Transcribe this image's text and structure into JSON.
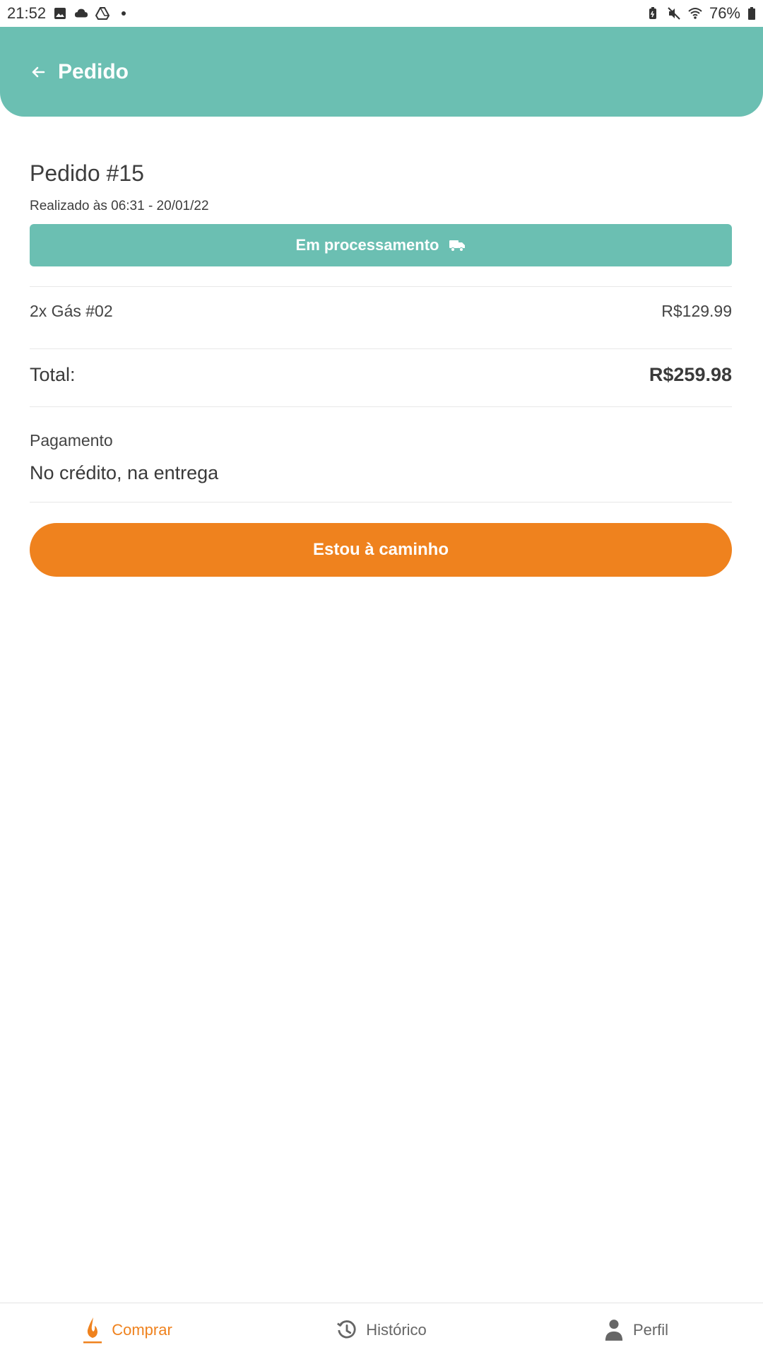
{
  "status_bar": {
    "time": "21:52",
    "battery": "76%",
    "left_icons": [
      "image-icon",
      "cloud-icon",
      "drive-icon",
      "dot-icon"
    ],
    "right_icons": [
      "battery-saver-icon",
      "mute-icon",
      "wifi-icon",
      "battery-icon"
    ]
  },
  "header": {
    "title": "Pedido",
    "back_icon": "arrow-left-icon"
  },
  "order": {
    "title": "Pedido #15",
    "date": "Realizado às 06:31 - 20/01/22",
    "status_label": "Em processamento",
    "status_icon": "truck-icon",
    "item_label": "2x Gás #02",
    "item_price": "R$129.99",
    "total_label": "Total:",
    "total_value": "R$259.98",
    "payment_label": "Pagamento",
    "payment_value": "No crédito, na entrega",
    "action_button": "Estou à caminho"
  },
  "nav": {
    "items": [
      {
        "label": "Comprar",
        "icon": "flame-icon",
        "active": true
      },
      {
        "label": "Histórico",
        "icon": "history-icon",
        "active": false
      },
      {
        "label": "Perfil",
        "icon": "person-icon",
        "active": false
      }
    ]
  },
  "colors": {
    "primary": "#6bbfb2",
    "accent": "#ef821e",
    "text": "#3a3a3a"
  }
}
